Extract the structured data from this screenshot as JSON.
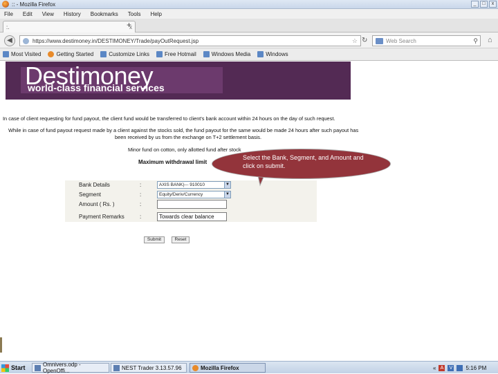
{
  "window": {
    "title": ":: - Mozilla Firefox",
    "controls": [
      "_",
      "□",
      "x"
    ]
  },
  "menu": [
    "File",
    "Edit",
    "View",
    "History",
    "Bookmarks",
    "Tools",
    "Help"
  ],
  "tab": {
    "label": ":.",
    "close": "x",
    "new": "+"
  },
  "nav": {
    "url": "https://www.destimoney.in/DESTIMONEY/Trade/payOutRequest.jsp",
    "search_placeholder": "Web Search"
  },
  "bookmarks": [
    "Most Visited",
    "Getting Started",
    "Customize Links",
    "Free Hotmail",
    "Windows Media",
    "Windows"
  ],
  "banner": {
    "brand": "Destimoney",
    "tagline": "world-class financial services"
  },
  "info": {
    "line1": "In case of client requesting for fund payout, the client fund would be transferred to client's bank account within 24 hours on the day of such request.",
    "line2": "While in case of fund payout request made by a client against the stocks sold, the fund payout for the same would be made 24 hours after such payout has",
    "line3": "been received by us from the exchange on T+2 settlement basis.",
    "line4": "Minor fund on cotton, only allotted fund after stock",
    "line5": "Maximum withdrawal limit"
  },
  "form": {
    "rows": [
      {
        "label": "Bank Details",
        "colon": ":",
        "value": "AXIS BANK|--- 910010"
      },
      {
        "label": "Segment",
        "colon": ":",
        "value": "Equity/Deriv/Currency"
      },
      {
        "label": "Amount ( Rs. )",
        "colon": ":",
        "value": ""
      },
      {
        "label": "Payment Remarks",
        "colon": ":",
        "value": "Towards clear balance"
      }
    ],
    "submit": "Submit",
    "reset": "Reset"
  },
  "callout": {
    "text": "Select the Bank, Segment, and Amount and click on submit."
  },
  "taskbar": {
    "start": "Start",
    "tasks": [
      "Omnivers.odp - OpenOffi...",
      "NEST Trader 3.13.57.96",
      "Mozilla Firefox"
    ],
    "clock": "5:16 PM"
  }
}
